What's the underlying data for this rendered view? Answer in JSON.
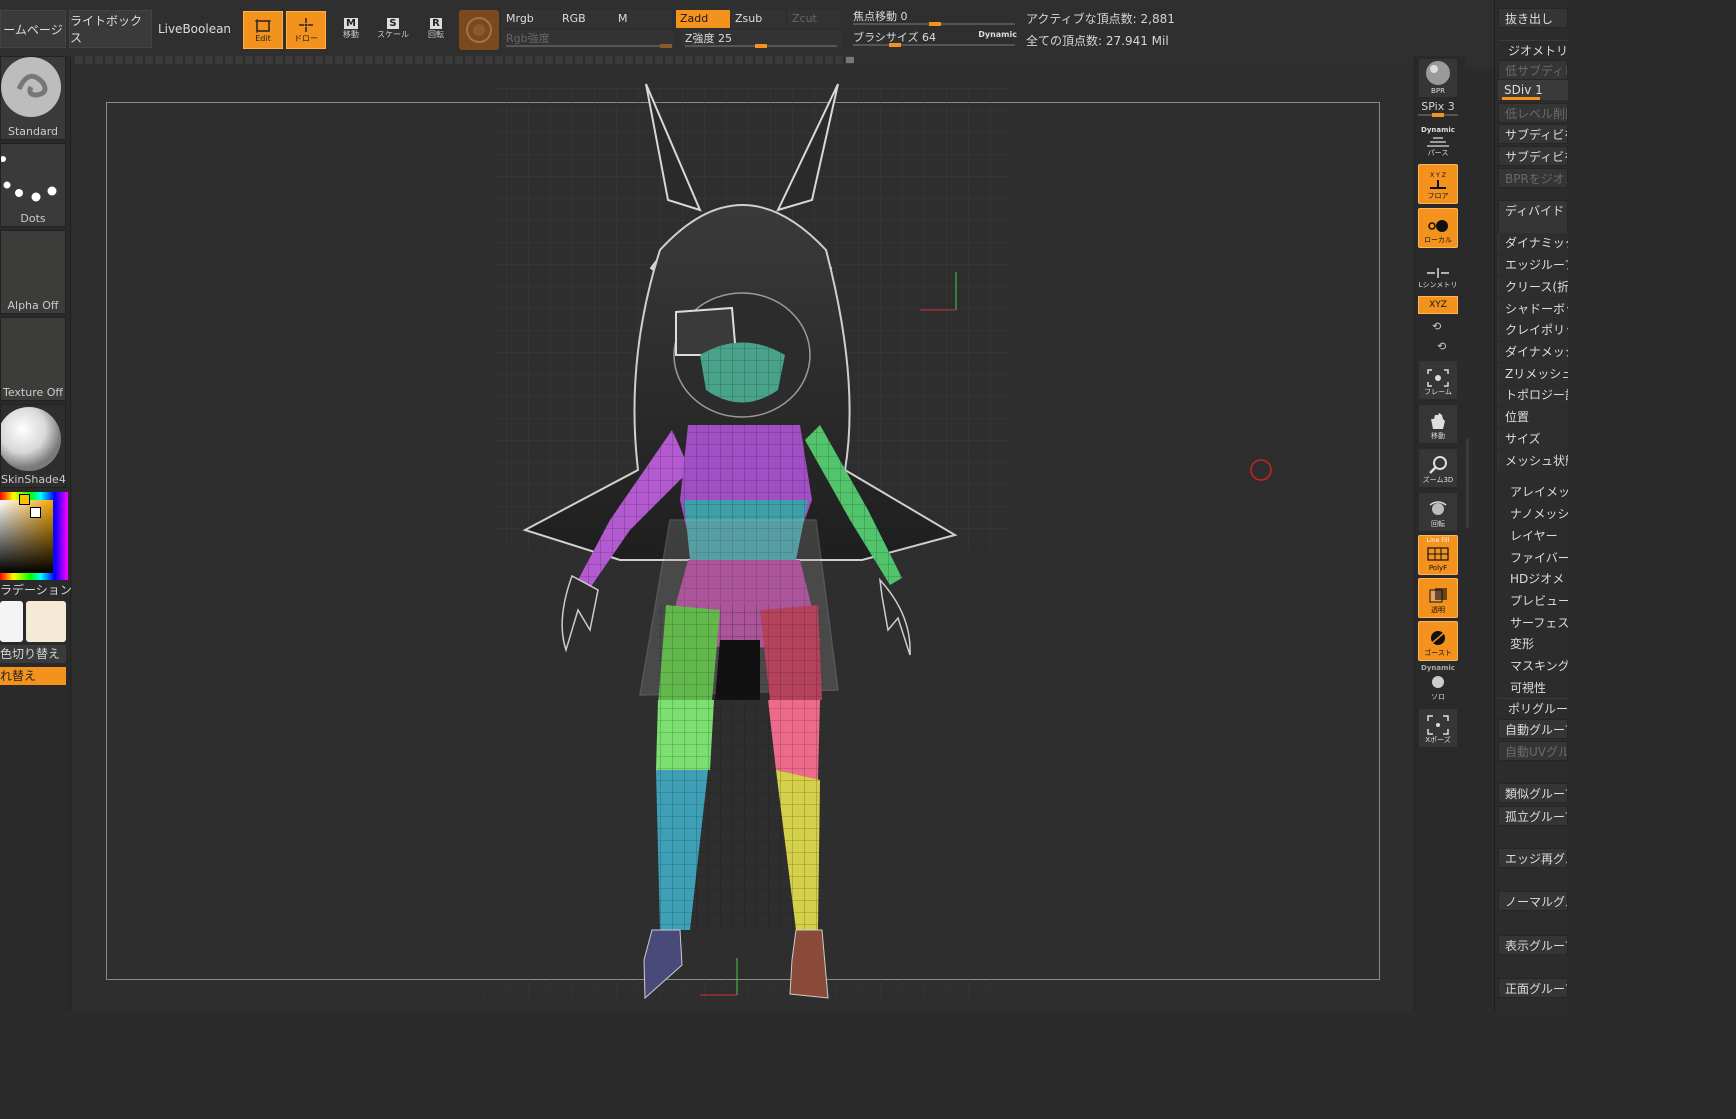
{
  "toolbar": {
    "home_page": "ームページ",
    "lightbox": "ライトボックス",
    "liveboolean": "LiveBoolean",
    "edit_label": "Edit",
    "draw_label": "ドロー",
    "move_label": "移動",
    "scale_label": "スケール",
    "rotate_label": "回転",
    "move_key": "M",
    "scale_key": "S",
    "rotate_key": "R",
    "mrgb": "Mrgb",
    "rgb": "RGB",
    "m": "M",
    "zadd": "Zadd",
    "zsub": "Zsub",
    "zcut": "Zcut",
    "rgb_intensity": "Rgb強度",
    "z_intensity": "Z強度 25",
    "focal_shift": "焦点移動 0",
    "brush_size": "ブラシサイズ 64",
    "dynamic": "Dynamic",
    "active_points": "アクティブな頂点数: 2,881",
    "total_points": "全ての頂点数: 27.941 Mil",
    "z_intensity_value": 25,
    "focal_shift_value": 0,
    "brush_size_value": 64
  },
  "left_tray": {
    "standard": "Standard",
    "dots": "Dots",
    "alpha_off": "Alpha Off",
    "texture_off": "Texture Off",
    "material": "SkinShade4",
    "gradient": "ラデーション",
    "switch_color": "色切り替え",
    "swap": "れ替え"
  },
  "right_tools": {
    "bpr": "BPR",
    "spix": "SPix 3",
    "dynamic": "Dynamic",
    "perspective": "パース",
    "floor": "フロア",
    "floor_axes": "X Y Z",
    "local": "ローカル",
    "symmetry": "Lシンメトリ",
    "xyz": "XYZ",
    "frame": "フレーム",
    "move": "移動",
    "zoom3d": "ズーム3D",
    "rotate": "回転",
    "linefill": "Line Fill",
    "polyf": "PolyF",
    "transp": "透明",
    "ghost": "ゴースト",
    "dynamic2": "Dynamic",
    "solo": "ソロ",
    "xpose": "Xポーズ"
  },
  "right_palette": {
    "items": [
      "抜き出し",
      "ジオメトリ",
      "低サブディビ",
      "SDiv 1",
      "低レベル削除",
      "サブディビを",
      "サブディビを",
      "BPRをジオメ",
      "ディバイド",
      "ダイナミック",
      "エッジループ",
      "クリース(折り",
      "シャドーボック",
      "クレイポリッシュ",
      "ダイナメッシュ",
      "Zリメッシュ",
      "トポロジー調",
      "位置",
      "サイズ",
      "メッシュ状態",
      "アレイメッシュ",
      "ナノメッシュ",
      "レイヤー",
      "ファイバーメ",
      "HDジオメトリ",
      "プレビュー",
      "サーフェス",
      "変形",
      "マスキング",
      "可視性",
      "ポリグループ",
      "自動グループ",
      "自動UVグルー",
      "類似グループ",
      "孤立グループ",
      "エッジ再グル",
      "ノーマルグル",
      "表示グループ",
      "正面グループ"
    ]
  },
  "colors": {
    "accent": "#f4921e",
    "panel": "#2f2f2f",
    "canvas": "#2e2e2e"
  }
}
